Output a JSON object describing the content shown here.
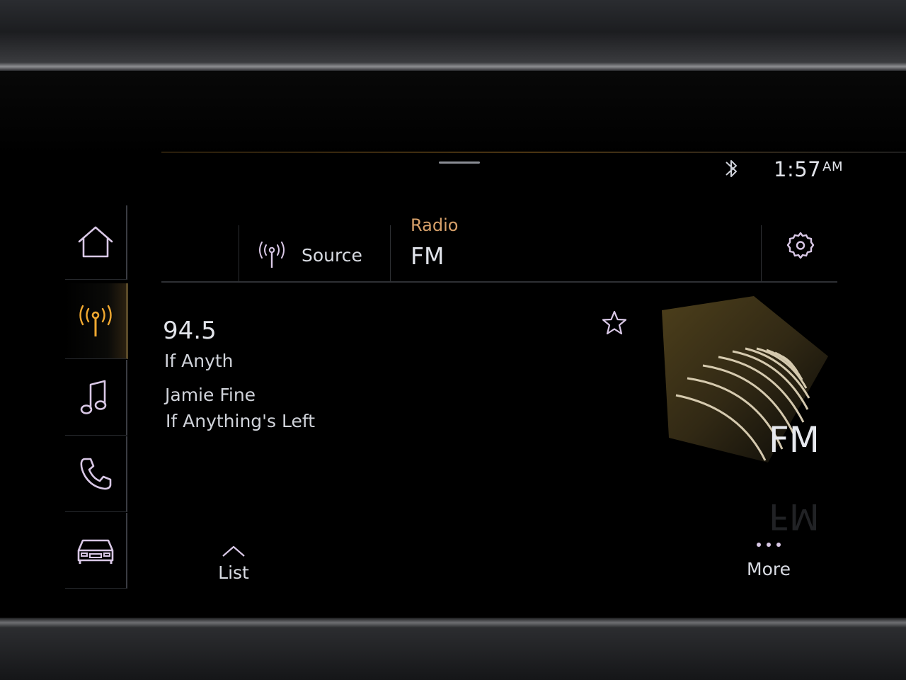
{
  "status": {
    "time": "1:57",
    "ampm": "AM",
    "bluetooth_icon": "bluetooth-icon"
  },
  "nav": {
    "items": [
      {
        "id": "home",
        "icon": "home-icon"
      },
      {
        "id": "radio",
        "icon": "radio-antenna-icon",
        "active": true
      },
      {
        "id": "media",
        "icon": "music-note-icon"
      },
      {
        "id": "phone",
        "icon": "phone-icon"
      },
      {
        "id": "car",
        "icon": "car-icon"
      }
    ]
  },
  "header": {
    "source_label": "Source",
    "title": "Radio",
    "subtitle": "FM"
  },
  "station": {
    "frequency": "94.5",
    "ps_name": "If Anyth",
    "artist": "Jamie Fine",
    "song": "If Anything's Left"
  },
  "artwork": {
    "band_label": "FM"
  },
  "footer": {
    "list_label": "List",
    "more_label": "More"
  },
  "colors": {
    "accent": "#d6a06a",
    "text": "#d8dbe2",
    "icon_lilac": "#d9c8e6",
    "active_icon": "#f0a830"
  }
}
